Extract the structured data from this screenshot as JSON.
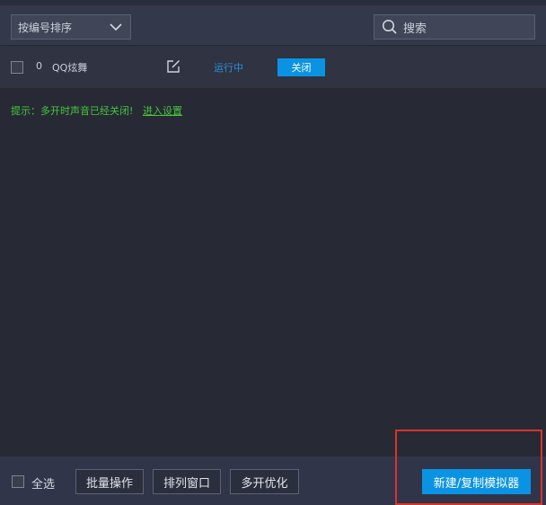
{
  "toolbar": {
    "sort_label": "按编号排序",
    "search_placeholder": "搜索"
  },
  "instance_rows": [
    {
      "index": "0",
      "name": "QQ炫舞",
      "status": "运行中",
      "action_label": "关闭"
    }
  ],
  "tip": {
    "text": "提示：多开时声音已经关闭!",
    "link_label": "进入设置"
  },
  "footer": {
    "select_all_label": "全选",
    "batch_label": "批量操作",
    "arrange_label": "排列窗口",
    "optimize_label": "多开优化",
    "new_label": "新建/复制模拟器"
  },
  "colors": {
    "accent": "#0b93e3",
    "status_running": "#2a8fd6",
    "tip_green": "#47c53e",
    "highlight_red": "#d8342c"
  }
}
